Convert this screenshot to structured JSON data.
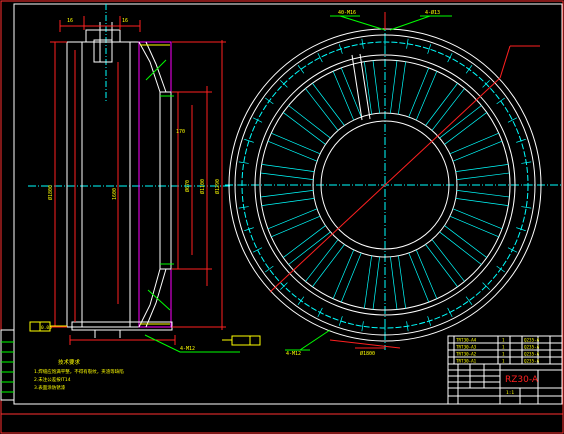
{
  "drawing": {
    "title_block": {
      "drawing_no": "RZ30-A",
      "scale": "1:1",
      "rows": [
        {
          "code": "TRT30-A4",
          "qty": "1",
          "mat": "Q235-A"
        },
        {
          "code": "TRT30-A3",
          "qty": "1",
          "mat": "Q235-A"
        },
        {
          "code": "TRT30-A2",
          "qty": "1",
          "mat": "Q235-A"
        },
        {
          "code": "TRT30-A1",
          "qty": "1",
          "mat": "Q235-A"
        }
      ]
    },
    "notes": {
      "title": "技术要求",
      "line1": "1.焊缝应饱满平整，不得有裂纹，夹渣等缺陷",
      "line2": "2.未注公差按IT14",
      "line3": "3.表面涂防锈漆"
    },
    "dims": {
      "side_top_1": "16",
      "side_top_2": "16",
      "side_left_total": "Ø1800",
      "side_inner": "1600",
      "side_mid": "Ø670",
      "side_right_1": "Ø1100",
      "side_right_2": "Ø1290",
      "side_step": "170",
      "side_bottom_left": "0.05",
      "side_bottom_right": "4-M12",
      "circle_top_1": "40-M16",
      "circle_top_2": "4-Ø13",
      "circle_bottom_1": "4-M12",
      "circle_bottom_2": "Ø1800"
    },
    "colors": {
      "background": "#000000",
      "outline": "#ffffff",
      "centerline": "#00ffff",
      "dimension": "#ff0000",
      "annotation": "#ffff00",
      "weld": "#ff00ff",
      "leader": "#00ff00"
    }
  }
}
